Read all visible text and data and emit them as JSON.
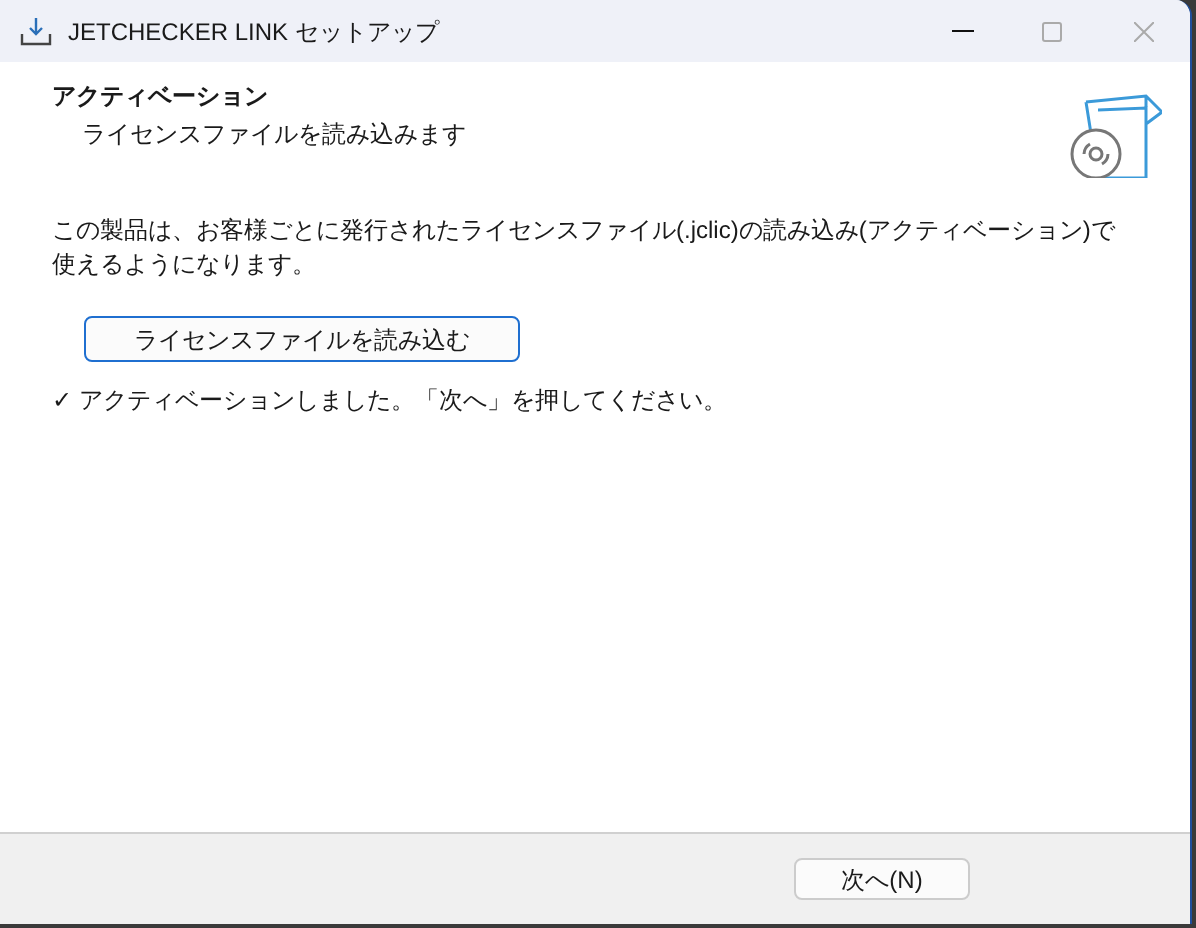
{
  "window": {
    "title": "JETCHECKER LINK セットアップ"
  },
  "header": {
    "title": "アクティベーション",
    "subtitle": "ライセンスファイルを読み込みます"
  },
  "description": "この製品は、お客様ごとに発行されたライセンスファイル(.jclic)の読み込み(アクティベーション)で使えるようになります。",
  "load_button": "ライセンスファイルを読み込む",
  "status": "✓ アクティベーションしました。「次へ」を押してください。",
  "buttons": [
    "次へ(N)"
  ]
}
